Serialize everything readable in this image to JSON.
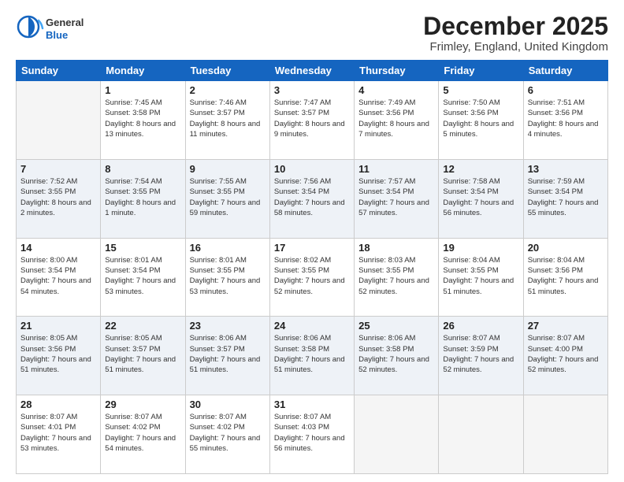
{
  "logo": {
    "general": "General",
    "blue": "Blue"
  },
  "header": {
    "month": "December 2025",
    "location": "Frimley, England, United Kingdom"
  },
  "weekdays": [
    "Sunday",
    "Monday",
    "Tuesday",
    "Wednesday",
    "Thursday",
    "Friday",
    "Saturday"
  ],
  "weeks": [
    [
      {
        "day": "",
        "empty": true
      },
      {
        "day": "1",
        "sunrise": "7:45 AM",
        "sunset": "3:58 PM",
        "daylight": "8 hours and 13 minutes."
      },
      {
        "day": "2",
        "sunrise": "7:46 AM",
        "sunset": "3:57 PM",
        "daylight": "8 hours and 11 minutes."
      },
      {
        "day": "3",
        "sunrise": "7:47 AM",
        "sunset": "3:57 PM",
        "daylight": "8 hours and 9 minutes."
      },
      {
        "day": "4",
        "sunrise": "7:49 AM",
        "sunset": "3:56 PM",
        "daylight": "8 hours and 7 minutes."
      },
      {
        "day": "5",
        "sunrise": "7:50 AM",
        "sunset": "3:56 PM",
        "daylight": "8 hours and 5 minutes."
      },
      {
        "day": "6",
        "sunrise": "7:51 AM",
        "sunset": "3:56 PM",
        "daylight": "8 hours and 4 minutes."
      }
    ],
    [
      {
        "day": "7",
        "sunrise": "7:52 AM",
        "sunset": "3:55 PM",
        "daylight": "8 hours and 2 minutes."
      },
      {
        "day": "8",
        "sunrise": "7:54 AM",
        "sunset": "3:55 PM",
        "daylight": "8 hours and 1 minute."
      },
      {
        "day": "9",
        "sunrise": "7:55 AM",
        "sunset": "3:55 PM",
        "daylight": "7 hours and 59 minutes."
      },
      {
        "day": "10",
        "sunrise": "7:56 AM",
        "sunset": "3:54 PM",
        "daylight": "7 hours and 58 minutes."
      },
      {
        "day": "11",
        "sunrise": "7:57 AM",
        "sunset": "3:54 PM",
        "daylight": "7 hours and 57 minutes."
      },
      {
        "day": "12",
        "sunrise": "7:58 AM",
        "sunset": "3:54 PM",
        "daylight": "7 hours and 56 minutes."
      },
      {
        "day": "13",
        "sunrise": "7:59 AM",
        "sunset": "3:54 PM",
        "daylight": "7 hours and 55 minutes."
      }
    ],
    [
      {
        "day": "14",
        "sunrise": "8:00 AM",
        "sunset": "3:54 PM",
        "daylight": "7 hours and 54 minutes."
      },
      {
        "day": "15",
        "sunrise": "8:01 AM",
        "sunset": "3:54 PM",
        "daylight": "7 hours and 53 minutes."
      },
      {
        "day": "16",
        "sunrise": "8:01 AM",
        "sunset": "3:55 PM",
        "daylight": "7 hours and 53 minutes."
      },
      {
        "day": "17",
        "sunrise": "8:02 AM",
        "sunset": "3:55 PM",
        "daylight": "7 hours and 52 minutes."
      },
      {
        "day": "18",
        "sunrise": "8:03 AM",
        "sunset": "3:55 PM",
        "daylight": "7 hours and 52 minutes."
      },
      {
        "day": "19",
        "sunrise": "8:04 AM",
        "sunset": "3:55 PM",
        "daylight": "7 hours and 51 minutes."
      },
      {
        "day": "20",
        "sunrise": "8:04 AM",
        "sunset": "3:56 PM",
        "daylight": "7 hours and 51 minutes."
      }
    ],
    [
      {
        "day": "21",
        "sunrise": "8:05 AM",
        "sunset": "3:56 PM",
        "daylight": "7 hours and 51 minutes."
      },
      {
        "day": "22",
        "sunrise": "8:05 AM",
        "sunset": "3:57 PM",
        "daylight": "7 hours and 51 minutes."
      },
      {
        "day": "23",
        "sunrise": "8:06 AM",
        "sunset": "3:57 PM",
        "daylight": "7 hours and 51 minutes."
      },
      {
        "day": "24",
        "sunrise": "8:06 AM",
        "sunset": "3:58 PM",
        "daylight": "7 hours and 51 minutes."
      },
      {
        "day": "25",
        "sunrise": "8:06 AM",
        "sunset": "3:58 PM",
        "daylight": "7 hours and 52 minutes."
      },
      {
        "day": "26",
        "sunrise": "8:07 AM",
        "sunset": "3:59 PM",
        "daylight": "7 hours and 52 minutes."
      },
      {
        "day": "27",
        "sunrise": "8:07 AM",
        "sunset": "4:00 PM",
        "daylight": "7 hours and 52 minutes."
      }
    ],
    [
      {
        "day": "28",
        "sunrise": "8:07 AM",
        "sunset": "4:01 PM",
        "daylight": "7 hours and 53 minutes."
      },
      {
        "day": "29",
        "sunrise": "8:07 AM",
        "sunset": "4:02 PM",
        "daylight": "7 hours and 54 minutes."
      },
      {
        "day": "30",
        "sunrise": "8:07 AM",
        "sunset": "4:02 PM",
        "daylight": "7 hours and 55 minutes."
      },
      {
        "day": "31",
        "sunrise": "8:07 AM",
        "sunset": "4:03 PM",
        "daylight": "7 hours and 56 minutes."
      },
      {
        "day": "",
        "empty": true
      },
      {
        "day": "",
        "empty": true
      },
      {
        "day": "",
        "empty": true
      }
    ]
  ]
}
